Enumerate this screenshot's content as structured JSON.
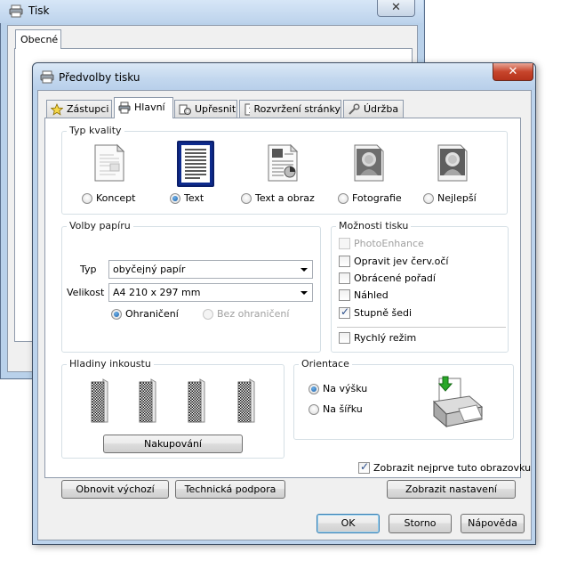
{
  "bg_window": {
    "title": "Tisk",
    "close_label": "✕",
    "tab_label": "Obecné"
  },
  "dialog": {
    "title": "Předvolby tisku",
    "close_label": "✕",
    "tabs": [
      {
        "label": "Zástupci",
        "icon": "star-icon"
      },
      {
        "label": "Hlavní",
        "icon": "printer-icon"
      },
      {
        "label": "Upřesnit",
        "icon": "settings-icon"
      },
      {
        "label": "Rozvržení stránky",
        "icon": "page-layout-icon"
      },
      {
        "label": "Údržba",
        "icon": "wrench-icon"
      }
    ],
    "active_tab": "Hlavní"
  },
  "quality": {
    "legend": "Typ kvality",
    "options": [
      {
        "label": "Koncept",
        "selected": false,
        "icon": "draft-page-icon"
      },
      {
        "label": "Text",
        "selected": true,
        "icon": "text-page-icon"
      },
      {
        "label": "Text a obraz",
        "selected": false,
        "icon": "text-image-page-icon"
      },
      {
        "label": "Fotografie",
        "selected": false,
        "icon": "photo-icon"
      },
      {
        "label": "Nejlepší",
        "selected": false,
        "icon": "best-photo-icon"
      }
    ]
  },
  "paper": {
    "legend": "Volby papíru",
    "type_label": "Typ",
    "type_value": "obyčejný papír",
    "size_label": "Velikost",
    "size_value": "A4 210 x 297 mm",
    "border_label": "Ohraničení",
    "borderless_label": "Bez ohraničení"
  },
  "options": {
    "legend": "Možnosti tisku",
    "items": [
      {
        "label": "PhotoEnhance",
        "checked": false,
        "disabled": true
      },
      {
        "label": "Opravit jev červ.očí",
        "checked": false,
        "disabled": false
      },
      {
        "label": "Obrácené pořadí",
        "checked": false,
        "disabled": false
      },
      {
        "label": "Náhled",
        "checked": false,
        "disabled": false
      },
      {
        "label": "Stupně šedi",
        "checked": true,
        "disabled": false
      }
    ],
    "fast_mode_label": "Rychlý režim",
    "fast_mode_checked": false
  },
  "ink": {
    "legend": "Hladiny inkoustu",
    "buy_label": "Nakupování"
  },
  "orientation": {
    "legend": "Orientace",
    "portrait_label": "Na výšku",
    "landscape_label": "Na šířku",
    "selected": "portrait"
  },
  "show_first": {
    "label": "Zobrazit nejprve tuto obrazovku",
    "checked": true
  },
  "buttons": {
    "restore_defaults": "Obnovit výchozí",
    "tech_support": "Technická podpora",
    "show_settings": "Zobrazit nastavení",
    "ok": "OK",
    "cancel": "Storno",
    "help": "Nápověda"
  },
  "colors": {
    "selection_frame": "#0b1f6b",
    "radio_selected": "#1a5fa8",
    "checkmark": "#2a4d8a",
    "close_button": "#c7452c"
  }
}
